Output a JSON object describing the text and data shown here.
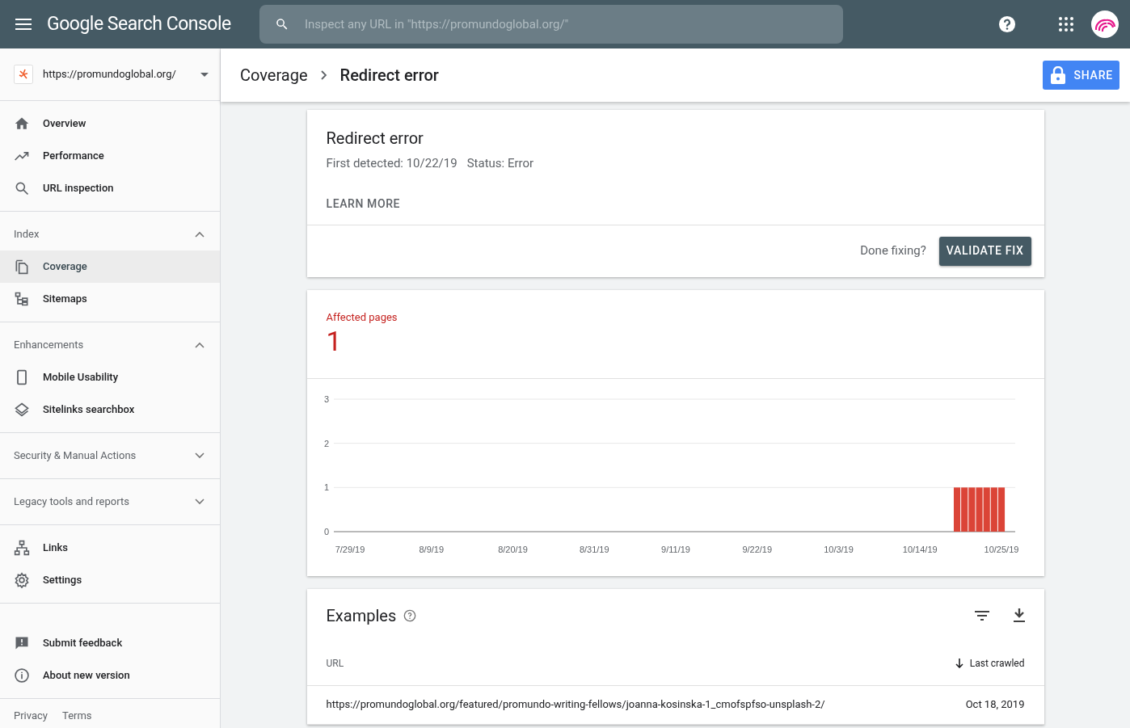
{
  "topbar": {
    "product": "Google Search Console",
    "search": {
      "placeholder": "Inspect any URL in \"https://promundoglobal.org/\""
    }
  },
  "sidebar": {
    "property": "https://promundoglobal.org/",
    "groups": [
      {
        "items": [
          {
            "label": "Overview",
            "selected": false
          },
          {
            "label": "Performance",
            "selected": false
          },
          {
            "label": "URL inspection",
            "selected": false
          }
        ]
      },
      {
        "header": "Index",
        "expanded": true,
        "items": [
          {
            "label": "Coverage",
            "selected": true
          },
          {
            "label": "Sitemaps",
            "selected": false
          }
        ]
      },
      {
        "header": "Enhancements",
        "expanded": true,
        "items": [
          {
            "label": "Mobile Usability",
            "selected": false
          },
          {
            "label": "Sitelinks searchbox",
            "selected": false
          }
        ]
      },
      {
        "header": "Security & Manual Actions",
        "expanded": false
      },
      {
        "header": "Legacy tools and reports",
        "expanded": false
      },
      {
        "items": [
          {
            "label": "Links",
            "selected": false
          },
          {
            "label": "Settings",
            "selected": false
          }
        ]
      },
      {
        "items": [
          {
            "label": "Submit feedback",
            "selected": false
          },
          {
            "label": "About new version",
            "selected": false
          }
        ]
      }
    ],
    "footer": [
      "Privacy",
      "Terms"
    ]
  },
  "breadcrumb": [
    "Coverage",
    "Redirect error"
  ],
  "share_button": "SHARE",
  "issue_card": {
    "title": "Redirect error",
    "first_detected": "First detected: 10/22/19",
    "status": "Status: Error",
    "learn_more": "LEARN MORE",
    "done_prompt": "Done fixing?",
    "validate_button": "VALIDATE FIX"
  },
  "affected_card": {
    "label": "Affected pages",
    "count": "1",
    "chart_data": {
      "type": "bar",
      "categories": [
        "7/29/19",
        null,
        null,
        null,
        null,
        null,
        null,
        null,
        null,
        null,
        null,
        "8/9/19",
        null,
        null,
        null,
        null,
        null,
        null,
        null,
        null,
        null,
        null,
        "8/20/19",
        null,
        null,
        null,
        null,
        null,
        null,
        null,
        null,
        null,
        null,
        "8/31/19",
        null,
        null,
        null,
        null,
        null,
        null,
        null,
        null,
        null,
        null,
        "9/11/19",
        null,
        null,
        null,
        null,
        null,
        null,
        null,
        null,
        null,
        null,
        "9/22/19",
        null,
        null,
        null,
        null,
        null,
        null,
        null,
        null,
        null,
        null,
        "10/3/19",
        null,
        null,
        null,
        null,
        null,
        null,
        null,
        null,
        null,
        null,
        "10/14/19",
        null,
        null,
        null,
        null,
        null,
        null,
        null,
        null,
        null,
        null,
        "10/25/19"
      ],
      "series": [
        {
          "color": "#db4437",
          "values": [
            0,
            0,
            0,
            0,
            0,
            0,
            0,
            0,
            0,
            0,
            0,
            0,
            0,
            0,
            0,
            0,
            0,
            0,
            0,
            0,
            0,
            0,
            0,
            0,
            0,
            0,
            0,
            0,
            0,
            0,
            0,
            0,
            0,
            0,
            0,
            0,
            0,
            0,
            0,
            0,
            0,
            0,
            0,
            0,
            0,
            0,
            0,
            0,
            0,
            0,
            0,
            0,
            0,
            0,
            0,
            0,
            0,
            0,
            0,
            0,
            0,
            0,
            0,
            0,
            0,
            0,
            0,
            0,
            0,
            0,
            0,
            0,
            0,
            0,
            0,
            0,
            0,
            0,
            0,
            0,
            0,
            0,
            1,
            1,
            1,
            1,
            1,
            1,
            1
          ]
        }
      ],
      "ylim": [
        0,
        3
      ],
      "yticks": [
        0,
        1,
        2,
        3
      ]
    }
  },
  "examples": {
    "title": "Examples",
    "columns": [
      "URL",
      "Last crawled"
    ],
    "rows": [
      {
        "url": "https://promundoglobal.org/featured/promundo-writing-fellows/joanna-kosinska-1_cmofspfso-unsplash-2/",
        "last_crawled": "Oct 18, 2019"
      }
    ]
  }
}
